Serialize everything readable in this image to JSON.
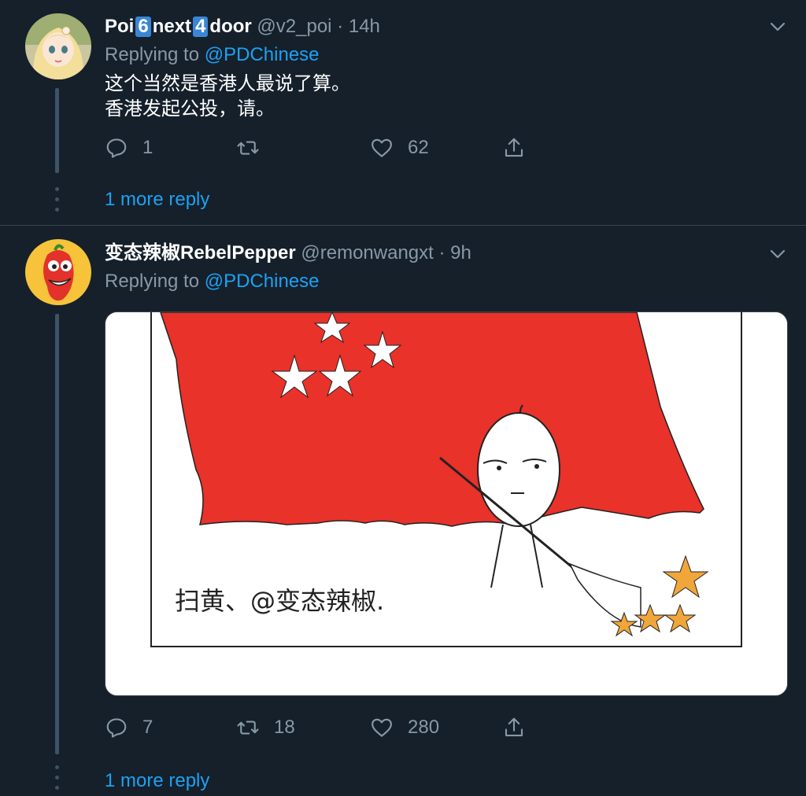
{
  "tweets": [
    {
      "name_parts": [
        "Poi",
        "6",
        "next",
        "4",
        "door"
      ],
      "handle": "@v2_poi",
      "sep": "·",
      "time": "14h",
      "replying_prefix": "Replying to",
      "replying_to": "@PDChinese",
      "text": "这个当然是香港人最说了算。\n香港发起公投，请。",
      "reply_count": "1",
      "retweet_count": "",
      "like_count": "62",
      "more_replies": "1 more reply"
    },
    {
      "name": "变态辣椒RebelPepper",
      "handle": "@remonwangxt",
      "sep": "·",
      "time": "9h",
      "replying_prefix": "Replying to",
      "replying_to": "@PDChinese",
      "media_caption": "扫黄、@变态辣椒.",
      "reply_count": "7",
      "retweet_count": "18",
      "like_count": "280",
      "more_replies": "1 more reply"
    }
  ],
  "colors": {
    "background": "#15202b",
    "accent": "#1da1f2",
    "muted": "#8899a6",
    "flag_red": "#e8322a",
    "star_orange": "#f0a63a"
  }
}
